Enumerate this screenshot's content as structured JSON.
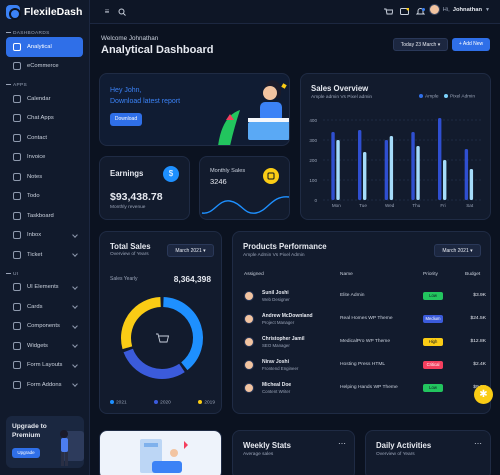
{
  "brand": {
    "name": "FlexileDash"
  },
  "sidebar": {
    "sections": [
      "DASHBOARDS",
      "APPS",
      "UI"
    ],
    "items": [
      {
        "label": "Analytical",
        "section": 0,
        "active": true
      },
      {
        "label": "eCommerce",
        "section": 0
      },
      {
        "label": "Calendar",
        "section": 1
      },
      {
        "label": "Chat Apps",
        "section": 1
      },
      {
        "label": "Contact",
        "section": 1
      },
      {
        "label": "Invoice",
        "section": 1
      },
      {
        "label": "Notes",
        "section": 1
      },
      {
        "label": "Todo",
        "section": 1
      },
      {
        "label": "Taskboard",
        "section": 1
      },
      {
        "label": "Inbox",
        "section": 1,
        "chevron": true
      },
      {
        "label": "Ticket",
        "section": 1,
        "chevron": true
      },
      {
        "label": "UI Elements",
        "section": 2,
        "chevron": true
      },
      {
        "label": "Cards",
        "section": 2,
        "chevron": true
      },
      {
        "label": "Components",
        "section": 2,
        "chevron": true
      },
      {
        "label": "Widgets",
        "section": 2,
        "chevron": true
      },
      {
        "label": "Form Layouts",
        "section": 2,
        "chevron": true
      },
      {
        "label": "Form Addons",
        "section": 2,
        "chevron": true
      }
    ],
    "upgrade": {
      "title": "Upgrade to Premium",
      "button": "Upgrade"
    }
  },
  "topbar": {
    "greeting": "Hi,",
    "username": "Johnathan"
  },
  "header": {
    "welcome": "Welcome Johnathan",
    "title": "Analytical Dashboard",
    "date": "Today 23 March",
    "add": "+ Add New"
  },
  "hero": {
    "line1": "Hey John,",
    "line2": "Download latest report",
    "button": "Download"
  },
  "sales_overview": {
    "title": "Sales Overview",
    "subtitle": "Ample admin Vs Pixel admin",
    "legend": [
      "Ample",
      "Pixel Admin"
    ],
    "yticks": [
      "400",
      "300",
      "200",
      "100",
      "0"
    ]
  },
  "earnings": {
    "title": "Earnings",
    "value": "$93,438.78",
    "label": "Monthly revenue",
    "icon": "$"
  },
  "monthly_sales": {
    "title": "Monthly Sales",
    "value": "3246"
  },
  "total_sales": {
    "title": "Total Sales",
    "subtitle": "Overview of Years",
    "select": "March 2021",
    "yearly_label": "Sales Yearly",
    "yearly_value": "8,364,398",
    "legend": [
      "2021",
      "2020",
      "2019"
    ]
  },
  "products": {
    "title": "Products Performance",
    "subtitle": "Ample Admin Vs Pixel Admin",
    "select": "March 2021",
    "columns": [
      "Assigned",
      "Name",
      "Priority",
      "Budget"
    ],
    "rows": [
      {
        "name": "Sunil Joshi",
        "role": "Web Designer",
        "project": "Elite Admin",
        "priority": "Low",
        "budget": "$3.9K",
        "color": "#22c55e"
      },
      {
        "name": "Andrew McDownland",
        "role": "Project Manager",
        "project": "Real Homes WP Theme",
        "priority": "Medium",
        "budget": "$24.5K",
        "color": "#3b5bdb"
      },
      {
        "name": "Christopher Jamil",
        "role": "SEO Manager",
        "project": "MedicalPro WP Theme",
        "priority": "High",
        "budget": "$12.8K",
        "color": "#facc15"
      },
      {
        "name": "Nirav Joshi",
        "role": "Frontend Engineer",
        "project": "Hosting Press HTML",
        "priority": "Critical",
        "budget": "$2.4K",
        "color": "#f43f5e"
      },
      {
        "name": "Micheal Doe",
        "role": "Content Writer",
        "project": "Helping Hands WP Theme",
        "priority": "Low",
        "budget": "$9.3K",
        "color": "#22c55e"
      }
    ]
  },
  "weekly": {
    "title": "Weekly Stats",
    "subtitle": "Average sales"
  },
  "daily": {
    "title": "Daily Activities",
    "subtitle": "Overview of Years"
  },
  "colors": {
    "accent": "#2f6fe8",
    "blue": "#1e90ff",
    "teal": "#7dd3fc",
    "yellow": "#facc15"
  },
  "chart_data": [
    {
      "type": "bar",
      "title": "Sales Overview",
      "categories": [
        "Mon",
        "Tue",
        "Wed",
        "Thu",
        "Fri",
        "Sat"
      ],
      "ylim": [
        0,
        400
      ],
      "series": [
        {
          "name": "Ample",
          "values": [
            340,
            350,
            300,
            340,
            410,
            255
          ]
        },
        {
          "name": "Pixel Admin",
          "values": [
            300,
            240,
            320,
            270,
            200,
            155
          ]
        }
      ]
    },
    {
      "type": "pie",
      "title": "Total Sales",
      "categories": [
        "2021",
        "2020",
        "2019"
      ],
      "values": [
        40,
        30,
        30
      ]
    }
  ]
}
